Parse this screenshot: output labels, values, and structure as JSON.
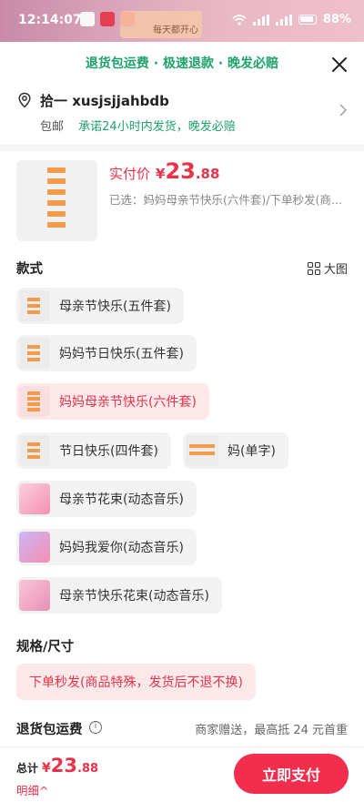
{
  "status_bar": {
    "time": "12:14:07",
    "ad_text": "每天都开心",
    "battery": "88%"
  },
  "sheet": {
    "banner": "退货包运费 · 极速退款 · 晚发必赔",
    "address": {
      "name": "拾一 xusjsjjahbdb",
      "free_shipping": "包邮",
      "promise": "承诺24小时内发货，晚发必赔"
    },
    "product": {
      "price_label": "实付价",
      "currency": "¥",
      "price_int": "23",
      "price_dec": ".88",
      "selected_text": "已选：妈妈母亲节快乐(六件套)/下单秒发(商品特殊，发货后不退不换)"
    },
    "style_section": {
      "title": "款式",
      "big_view": "大图",
      "options": [
        {
          "label": "母亲节快乐(五件套)",
          "selected": false
        },
        {
          "label": "妈妈节日快乐(五件套)",
          "selected": false
        },
        {
          "label": "妈妈母亲节快乐(六件套)",
          "selected": true
        },
        {
          "label": "节日快乐(四件套)",
          "selected": false
        },
        {
          "label": "妈(单字)",
          "selected": false
        },
        {
          "label": "母亲节花束(动态音乐)",
          "selected": false
        },
        {
          "label": "妈妈我爱你(动态音乐)",
          "selected": false
        },
        {
          "label": "母亲节快乐花束(动态音乐)",
          "selected": false
        }
      ]
    },
    "spec_section": {
      "title": "规格/尺寸",
      "options": [
        {
          "label": "下单秒发(商品特殊，发货后不退不换)",
          "selected": true
        }
      ]
    },
    "return_shipping": {
      "title": "退货包运费",
      "note": "商家赠送，最高抵 24 元首重"
    },
    "footer": {
      "total_label": "总计",
      "currency": "¥",
      "total_int": "23",
      "total_dec": ".88",
      "detail_label": "明细^",
      "pay_button": "立即支付"
    }
  },
  "colors": {
    "accent": "#e8334a",
    "green": "#1fa26b",
    "pay_button": "#f12e4d"
  }
}
